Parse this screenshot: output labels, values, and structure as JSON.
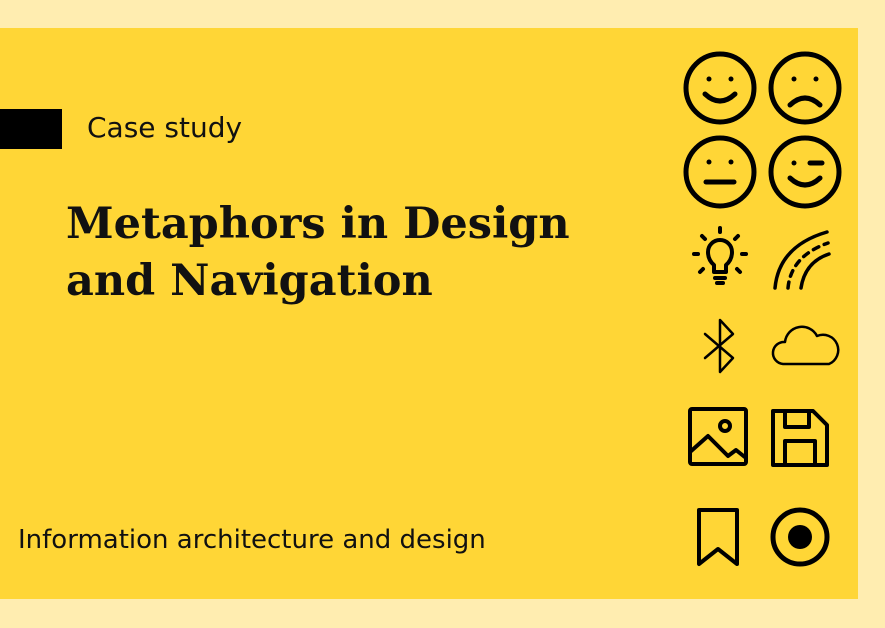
{
  "tag": {
    "label": "Case study"
  },
  "title": {
    "line1": "Metaphors in Design",
    "line2": "and Navigation"
  },
  "subtitle": "Information architecture and design",
  "icons": [
    "smiling-face-icon",
    "frowning-face-icon",
    "neutral-face-icon",
    "winking-face-icon",
    "lightbulb-icon",
    "road-icon",
    "bluetooth-icon",
    "cloud-icon",
    "image-icon",
    "floppy-disk-icon",
    "bookmark-icon",
    "radio-button-icon"
  ],
  "colors": {
    "page_background": "#FFEDB0",
    "card_background": "#FFD636",
    "ink": "#000000"
  }
}
